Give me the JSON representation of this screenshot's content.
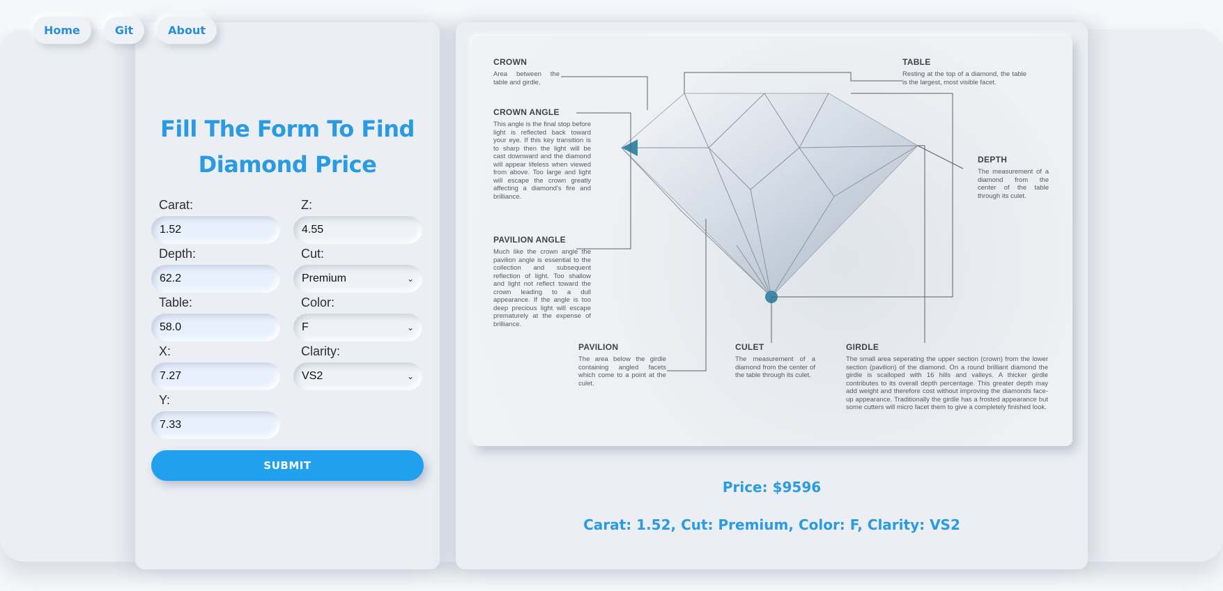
{
  "nav": {
    "items": [
      "Home",
      "Git",
      "About"
    ]
  },
  "form": {
    "title_line1": "Fill The Form To Find",
    "title_line2": "Diamond Price",
    "fields": {
      "carat": {
        "label": "Carat:",
        "value": "1.52"
      },
      "depth": {
        "label": "Depth:",
        "value": "62.2"
      },
      "table": {
        "label": "Table:",
        "value": "58.0"
      },
      "x": {
        "label": "X:",
        "value": "7.27"
      },
      "y": {
        "label": "Y:",
        "value": "7.33"
      },
      "z": {
        "label": "Z:",
        "value": "4.55"
      },
      "cut": {
        "label": "Cut:",
        "value": "Premium"
      },
      "color": {
        "label": "Color:",
        "value": "F"
      },
      "clarity": {
        "label": "Clarity:",
        "value": "VS2"
      }
    },
    "submit_label": "SUBMIT"
  },
  "infographic": {
    "crown": {
      "title": "CROWN",
      "desc": "Area between the table and girdle."
    },
    "crown_angle": {
      "title": "CROWN ANGLE",
      "desc": "This angle is the final stop before light is reflected back toward your eye. If this key transition is to sharp then the light will be cast downward and the diamond will appear lifeless when viewed from above. Too large and light will escape the crown greatly affecting a diamond's fire and brilliance."
    },
    "pavilion_angle": {
      "title": "PAVILION ANGLE",
      "desc": "Much like the crown angle the pavilion angle is essential to the collection and subsequent reflection of light. Too shallow and light not reflect toward the crown leading to a dull appearance. If the angle is too deep precious light will escape prematurely at the expense of brilliance."
    },
    "pavilion": {
      "title": "PAVILION",
      "desc": "The area below the girdle containing angled facets which come to a point at the culet."
    },
    "culet": {
      "title": "CULET",
      "desc": "The measurement of a diamond from the center of the table through its culet."
    },
    "girdle": {
      "title": "GIRDLE",
      "desc": "The small area seperating the upper section (crown) from the lower section (pavilion) of the diamond. On a round brilliant diamond the girdle is scalloped with 16 hills and valleys. A thicker girdle contributes to its overall depth percentage. This greater depth may add weight and therefore cost without improving the diamonds face-up appearance. Traditionally the girdle has a frosted appearance but some cutters will micro facet them to give a completely finished look."
    },
    "table": {
      "title": "TABLE",
      "desc": "Resting at the top of a diamond, the table is the largest, most visible facet."
    },
    "depth": {
      "title": "DEPTH",
      "desc": "The measurement of a diamond from the center of the table through its culet."
    }
  },
  "result": {
    "price": "Price: $9596",
    "summary": "Carat: 1.52, Cut: Premium, Color: F, Clarity: VS2"
  },
  "colors": {
    "accent": "#2a9be3",
    "button": "#21a0ee",
    "panel": "#ebeef2"
  }
}
